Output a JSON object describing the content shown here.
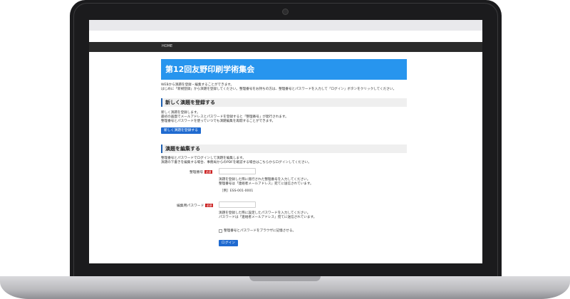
{
  "nav": {
    "home": "HOME"
  },
  "site": {
    "title": "第12回友野印刷学術集会"
  },
  "intro": {
    "line1": "WEBから演題を登録・編集することができます。",
    "line2": "はじめに「新規登録」から演題を登録してください。整理番号をお持ちの方は、整理番号とパスワードを入力して「ログイン」ボタンをクリックしてください。"
  },
  "register": {
    "heading": "新しく演題を登録する",
    "line1": "新しく演題を登録します。",
    "line2": "最初の画面でメールアドレスとパスワードを登録すると「整理番号」が発行されます。",
    "line3": "整理番号とパスワードを使っていつでも演題編集を再開することができます。",
    "button": "新しく演題を登録する"
  },
  "edit": {
    "heading": "演題を編集する",
    "line1": "整理番号とパスワードでログインして演題を編集します。",
    "line2": "演題の下書きを編集する場合、事務局からのPDFを確認する場合はこちらからログインしてください。",
    "required": "必須",
    "id_label": "整理番号",
    "id_help1": "演題を登録した際に発行された整理番号を入力してください。",
    "id_help2": "整理番号は「連絡者メールアドレス」宛てに送信されています。",
    "id_example": "［例］ESS-001-0001",
    "pw_label": "編集用パスワード",
    "pw_help1": "演題を登録した際に設定したパスワードを入力してください。",
    "pw_help2": "パスワードは「連絡者メールアドレス」宛てに送信されています。",
    "remember": "整理番号とパスワードをブラウザに記憶させる。",
    "login_button": "ログイン"
  },
  "colors": {
    "title_bg": "#2795ee",
    "button_bg": "#1f6ad0",
    "required_badge": "#cc2222",
    "nav_bg": "#2a2a2a"
  }
}
